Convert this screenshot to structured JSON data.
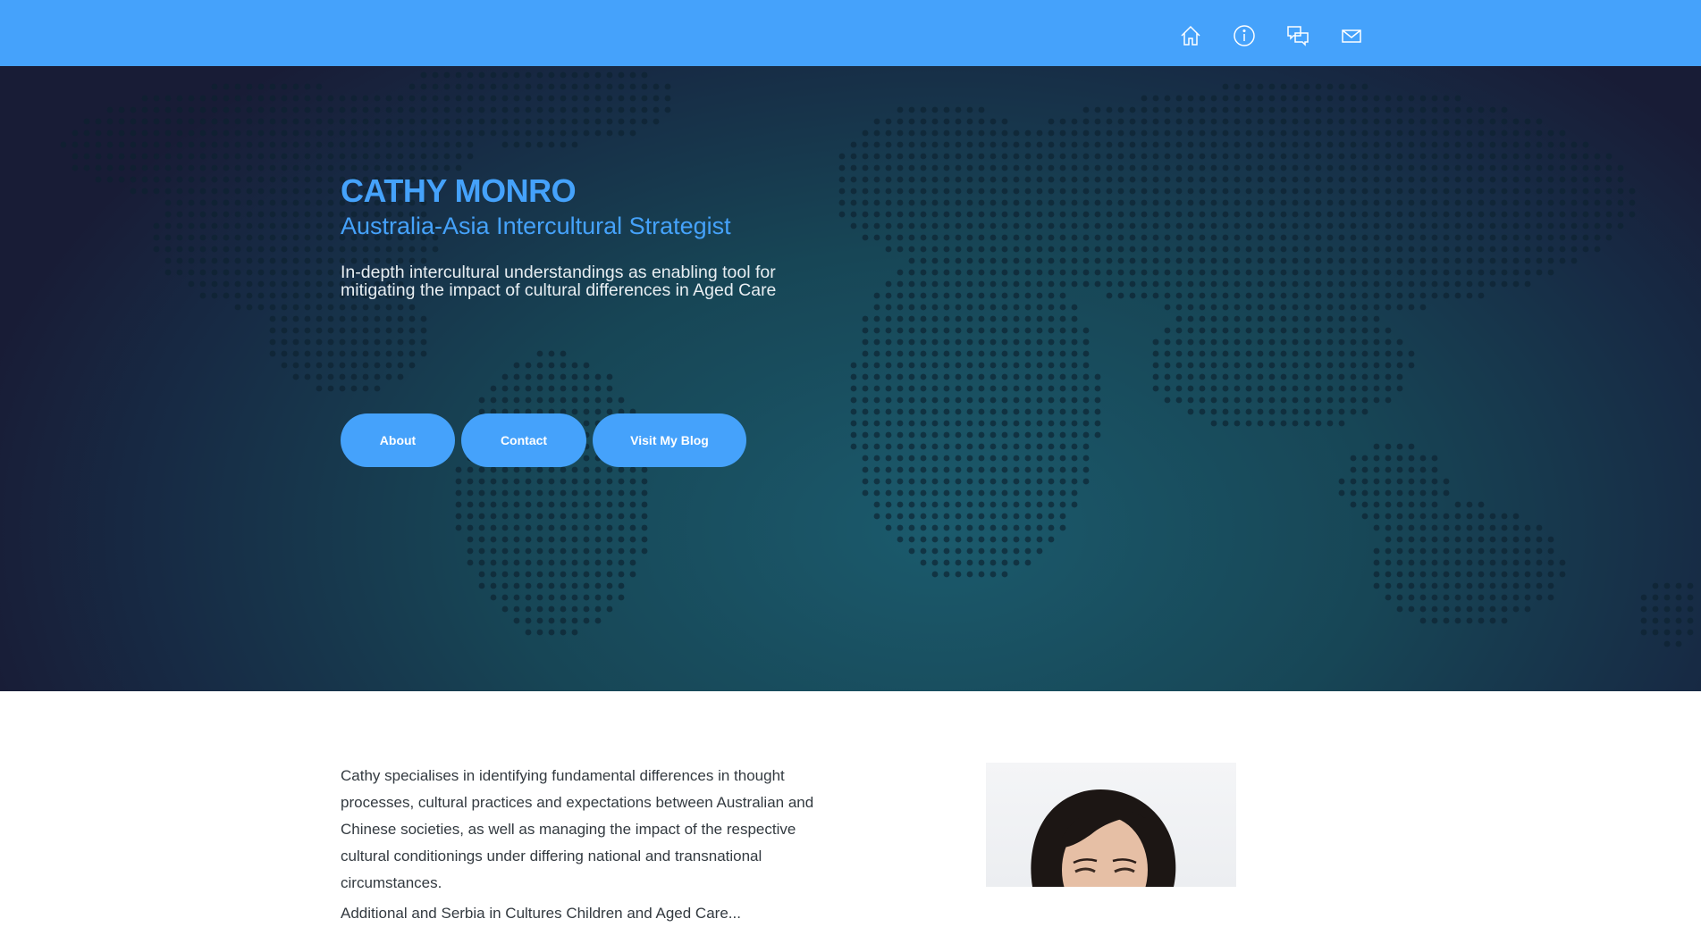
{
  "nav": {
    "icons": [
      "home-icon",
      "info-icon",
      "chat-icon",
      "mail-icon"
    ],
    "background_color": "#45a2fb"
  },
  "hero": {
    "name": "CATHY MONRO",
    "title": "Australia-Asia Intercultural Strategist",
    "tagline": "In-depth intercultural understandings as enabling tool for mitigating the impact of cultural differences in Aged Care",
    "buttons": {
      "about": "About",
      "contact": "Contact",
      "blog": "Visit My Blog"
    },
    "accent_color": "#45a2fb"
  },
  "intro": {
    "paragraph": "Cathy specialises in identifying fundamental differences in thought processes, cultural practices and expectations between Australian and Chinese societies, as well as managing the impact of the respective cultural conditionings under differing national and transnational circumstances.",
    "second_line": "Additional and Serbia in Cultures Children and Aged Care..."
  }
}
